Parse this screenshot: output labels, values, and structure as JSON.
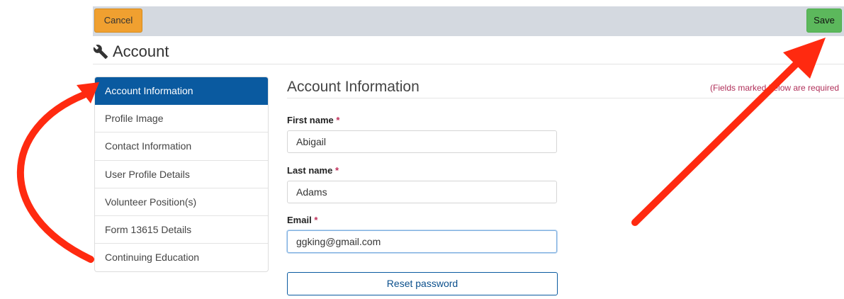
{
  "toolbar": {
    "cancel_label": "Cancel",
    "save_label": "Save"
  },
  "page": {
    "icon": "wrench-icon",
    "title": "Account"
  },
  "sidebar": {
    "items": [
      {
        "label": "Account Information",
        "active": true
      },
      {
        "label": "Profile Image",
        "active": false
      },
      {
        "label": "Contact Information",
        "active": false
      },
      {
        "label": "User Profile Details",
        "active": false
      },
      {
        "label": "Volunteer Position(s)",
        "active": false
      },
      {
        "label": "Form 13615 Details",
        "active": false
      },
      {
        "label": "Continuing Education",
        "active": false
      }
    ]
  },
  "form": {
    "title": "Account Information",
    "required_note": "(Fields marked below are required",
    "required_marker": "*",
    "fields": [
      {
        "label": "First name",
        "value": "Abigail"
      },
      {
        "label": "Last name",
        "value": "Adams"
      },
      {
        "label": "Email",
        "value": "ggking@gmail.com",
        "focused": true
      }
    ],
    "reset_label": "Reset password"
  },
  "annotations": {
    "color": "#ff2a10"
  },
  "colors": {
    "primary": "#0a5aa0",
    "cancel": "#f0a030",
    "save": "#5cb85c",
    "required": "#c0305a"
  }
}
